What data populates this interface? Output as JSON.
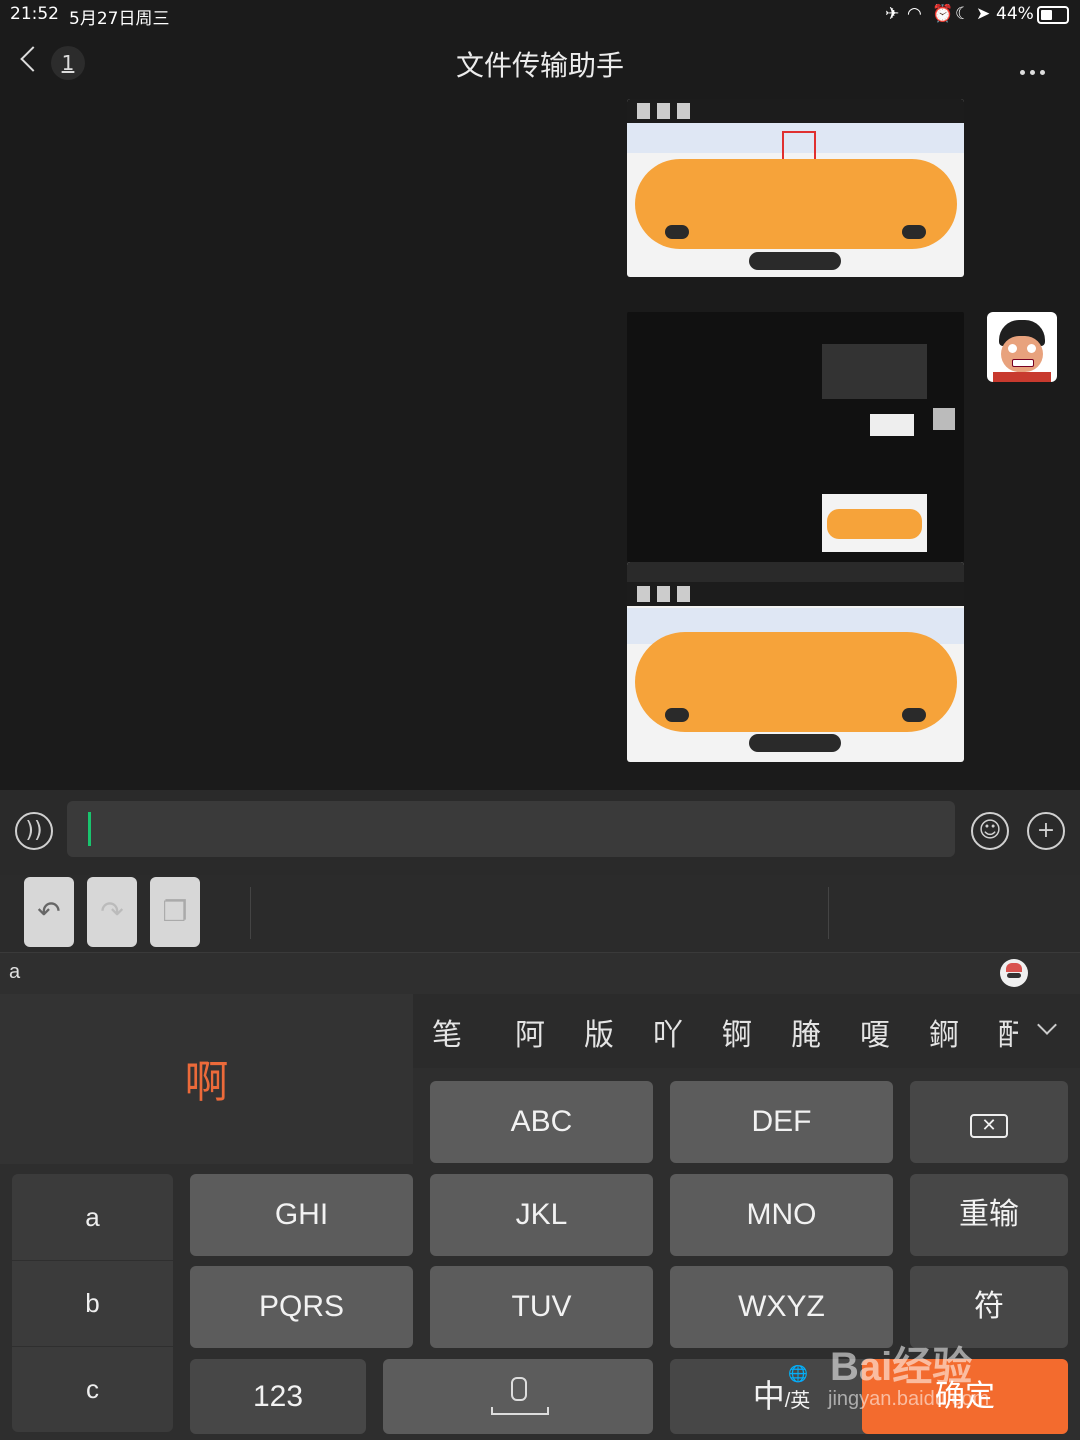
{
  "status": {
    "time": "21:52",
    "date": "5月27日周三",
    "battery": "44%"
  },
  "nav": {
    "back_count": "1",
    "title": "文件传输助手"
  },
  "input": {
    "placeholder": ""
  },
  "pinyin": {
    "text": "a"
  },
  "preview": {
    "char": "啊"
  },
  "candidates": [
    "笔",
    "阿",
    "版",
    "吖",
    "锕",
    "腌",
    "嗄",
    "錒",
    "酐"
  ],
  "keys": {
    "abc": "ABC",
    "def": "DEF",
    "ghi": "GHI",
    "jkl": "JKL",
    "mno": "MNO",
    "pqrs": "PQRS",
    "tuv": "TUV",
    "wxyz": "WXYZ",
    "reenter": "重输",
    "symbol": "符",
    "num": "123",
    "lang_main": "中",
    "lang_sub": "/英",
    "enter": "确定"
  },
  "left_col": [
    "a",
    "b",
    "c"
  ],
  "watermark": {
    "brand": "Bai经验",
    "url": "jingyan.baidu.com"
  },
  "colors": {
    "accent": "#f36b2e",
    "caret": "#19c46e",
    "preview": "#ec6a3a"
  }
}
